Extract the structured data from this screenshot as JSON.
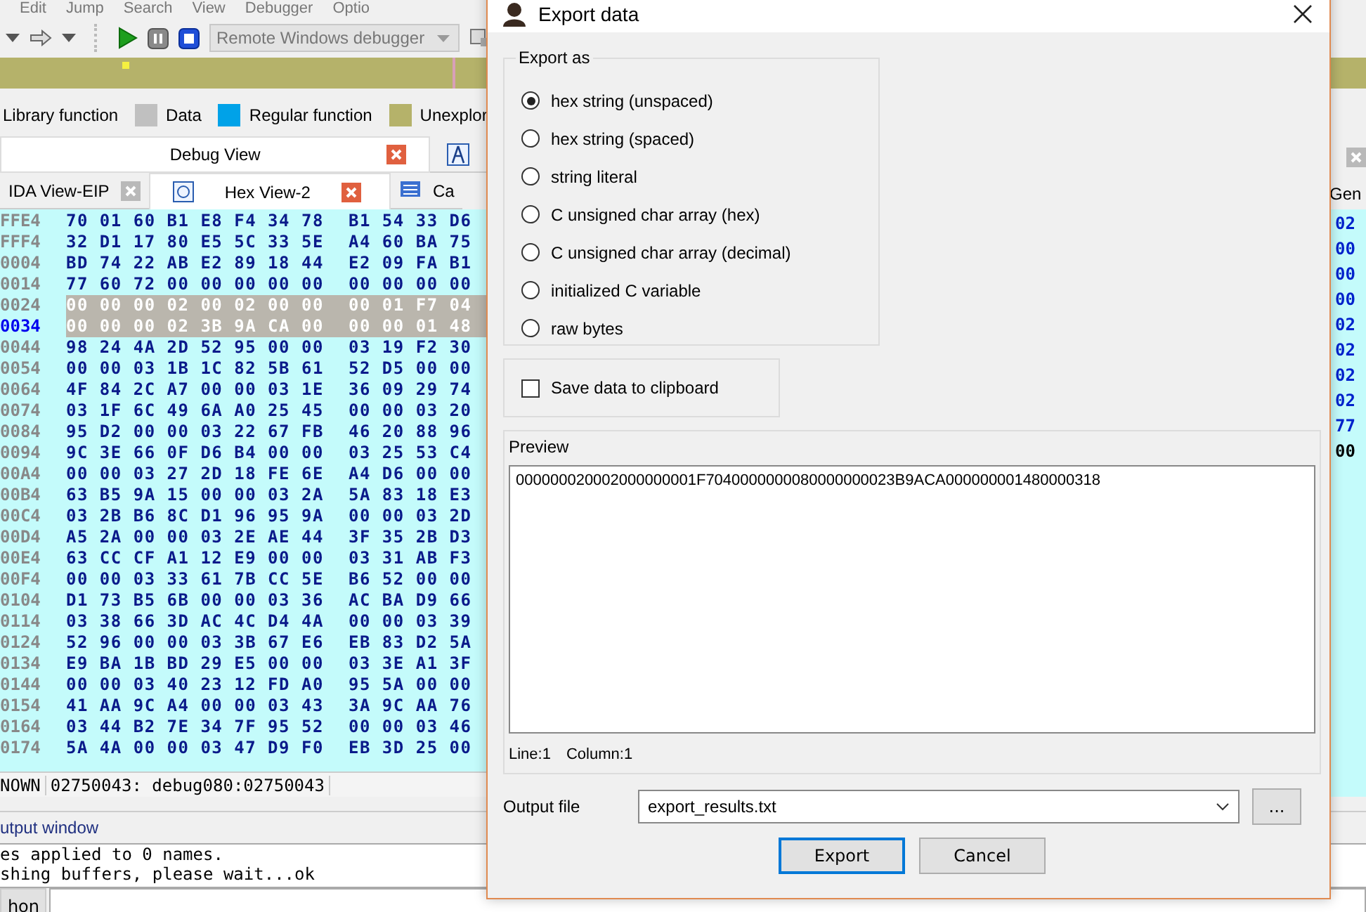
{
  "menu": [
    "Edit",
    "Jump",
    "Search",
    "View",
    "Debugger",
    "Optio"
  ],
  "toolbar": {
    "debugger": "Remote Windows debugger"
  },
  "legend": [
    {
      "label": "Library function"
    },
    {
      "label": "Data",
      "color": "#c0c0c0"
    },
    {
      "label": "Regular function",
      "color": "#00a2e8"
    },
    {
      "label": "Unexplor",
      "color": "#b5b26a"
    }
  ],
  "view_tabs": [
    {
      "label": "Debug View",
      "selected": true
    },
    {
      "selected": false
    }
  ],
  "tabs": [
    {
      "label": "IDA View-EIP",
      "selected": false
    },
    {
      "label": "Hex View-2",
      "selected": true
    },
    {
      "label": "Ca",
      "selected": false
    }
  ],
  "hex_rows": [
    {
      "address": "FFE4",
      "bytes": [
        "70 01 60 B1 E8 F4 34 78",
        "B1 54 33 D6"
      ],
      "selected": false,
      "current": false
    },
    {
      "address": "FFF4",
      "bytes": [
        "32 D1 17 80 E5 5C 33 5E",
        "A4 60 BA 75"
      ],
      "selected": false,
      "current": false
    },
    {
      "address": "0004",
      "bytes": [
        "BD 74 22 AB E2 89 18 44",
        "E2 09 FA B1"
      ],
      "selected": false,
      "current": false
    },
    {
      "address": "0014",
      "bytes": [
        "77 60 72 00 00 00 00 00",
        "00 00 00 00"
      ],
      "selected": false,
      "current": false
    },
    {
      "address": "0024",
      "bytes": [
        "00 00 00 02 00 02 00 00",
        "00 01 F7 04"
      ],
      "selected": true,
      "current": false
    },
    {
      "address": "0034",
      "bytes": [
        "00 00 00 02 3B 9A CA 00",
        "00 00 01 48"
      ],
      "selected": true,
      "current": true
    },
    {
      "address": "0044",
      "bytes": [
        "98 24 4A 2D 52 95 00 00",
        "03 19 F2 30"
      ],
      "selected": false,
      "current": false
    },
    {
      "address": "0054",
      "bytes": [
        "00 00 03 1B 1C 82 5B 61",
        "52 D5 00 00"
      ],
      "selected": false,
      "current": false
    },
    {
      "address": "0064",
      "bytes": [
        "4F 84 2C A7 00 00 03 1E",
        "36 09 29 74"
      ],
      "selected": false,
      "current": false
    },
    {
      "address": "0074",
      "bytes": [
        "03 1F 6C 49 6A A0 25 45",
        "00 00 03 20"
      ],
      "selected": false,
      "current": false
    },
    {
      "address": "0084",
      "bytes": [
        "95 D2 00 00 03 22 67 FB",
        "46 20 88 96"
      ],
      "selected": false,
      "current": false
    },
    {
      "address": "0094",
      "bytes": [
        "9C 3E 66 0F D6 B4 00 00",
        "03 25 53 C4"
      ],
      "selected": false,
      "current": false
    },
    {
      "address": "00A4",
      "bytes": [
        "00 00 03 27 2D 18 FE 6E",
        "A4 D6 00 00"
      ],
      "selected": false,
      "current": false
    },
    {
      "address": "00B4",
      "bytes": [
        "63 B5 9A 15 00 00 03 2A",
        "5A 83 18 E3"
      ],
      "selected": false,
      "current": false
    },
    {
      "address": "00C4",
      "bytes": [
        "03 2B B6 8C D1 96 95 9A",
        "00 00 03 2D"
      ],
      "selected": false,
      "current": false
    },
    {
      "address": "00D4",
      "bytes": [
        "A5 2A 00 00 03 2E AE 44",
        "3F 35 2B D3"
      ],
      "selected": false,
      "current": false
    },
    {
      "address": "00E4",
      "bytes": [
        "63 CC CF A1 12 E9 00 00",
        "03 31 AB F3"
      ],
      "selected": false,
      "current": false
    },
    {
      "address": "00F4",
      "bytes": [
        "00 00 03 33 61 7B CC 5E",
        "B6 52 00 00"
      ],
      "selected": false,
      "current": false
    },
    {
      "address": "0104",
      "bytes": [
        "D1 73 B5 6B 00 00 03 36",
        "AC BA D9 66"
      ],
      "selected": false,
      "current": false
    },
    {
      "address": "0114",
      "bytes": [
        "03 38 66 3D AC 4C D4 4A",
        "00 00 03 39"
      ],
      "selected": false,
      "current": false
    },
    {
      "address": "0124",
      "bytes": [
        "52 96 00 00 03 3B 67 E6",
        "EB 83 D2 5A"
      ],
      "selected": false,
      "current": false
    },
    {
      "address": "0134",
      "bytes": [
        "E9 BA 1B BD 29 E5 00 00",
        "03 3E A1 3F"
      ],
      "selected": false,
      "current": false
    },
    {
      "address": "0144",
      "bytes": [
        "00 00 03 40 23 12 FD A0",
        "95 5A 00 00"
      ],
      "selected": false,
      "current": false
    },
    {
      "address": "0154",
      "bytes": [
        "41 AA 9C A4 00 00 03 43",
        "3A 9C AA 76"
      ],
      "selected": false,
      "current": false
    },
    {
      "address": "0164",
      "bytes": [
        "03 44 B2 7E 34 7F 95 52",
        "00 00 03 46"
      ],
      "selected": false,
      "current": false
    },
    {
      "address": "0174",
      "bytes": [
        "5A 4A 00 00 03 47 D9 F0",
        "EB 3D 25 00"
      ],
      "selected": false,
      "current": false
    }
  ],
  "hex_status": {
    "segment": "NOWN",
    "location": "02750043: debug080:02750043"
  },
  "side_pane": {
    "tab": "Gen",
    "values": [
      {
        "text": "02",
        "highlighted": false
      },
      {
        "text": "00",
        "highlighted": false
      },
      {
        "text": "00",
        "highlighted": false
      },
      {
        "text": "00",
        "highlighted": false
      },
      {
        "text": "02",
        "highlighted": false
      },
      {
        "text": "02",
        "highlighted": false
      },
      {
        "text": "02",
        "highlighted": false
      },
      {
        "text": "02",
        "highlighted": false
      },
      {
        "text": "77",
        "highlighted": false
      },
      {
        "text": "00",
        "highlighted": true
      }
    ]
  },
  "output": {
    "title": "utput window",
    "lines": [
      "es applied to 0 names.",
      "shing buffers, please wait...ok"
    ],
    "language_button": "hon"
  },
  "dialog": {
    "title": "Export data",
    "export_as": {
      "title": "Export as",
      "options": [
        {
          "label": "hex string (unspaced)",
          "selected": true
        },
        {
          "label": "hex string (spaced)",
          "selected": false
        },
        {
          "label": "string literal",
          "selected": false
        },
        {
          "label": "C unsigned char array (hex)",
          "selected": false
        },
        {
          "label": "C unsigned char array (decimal)",
          "selected": false
        },
        {
          "label": "initialized C variable",
          "selected": false
        },
        {
          "label": "raw bytes",
          "selected": false
        }
      ]
    },
    "clipboard": {
      "label": "Save data to clipboard",
      "checked": false
    },
    "preview": {
      "title": "Preview",
      "text": "000000020002000000001F7040000000080000000023B9ACA000000001480000318",
      "line": "Line:1",
      "column": "Column:1"
    },
    "output_file": {
      "label": "Output file",
      "value": "export_results.txt",
      "browse": "..."
    },
    "buttons": [
      "Export",
      "Cancel"
    ]
  }
}
